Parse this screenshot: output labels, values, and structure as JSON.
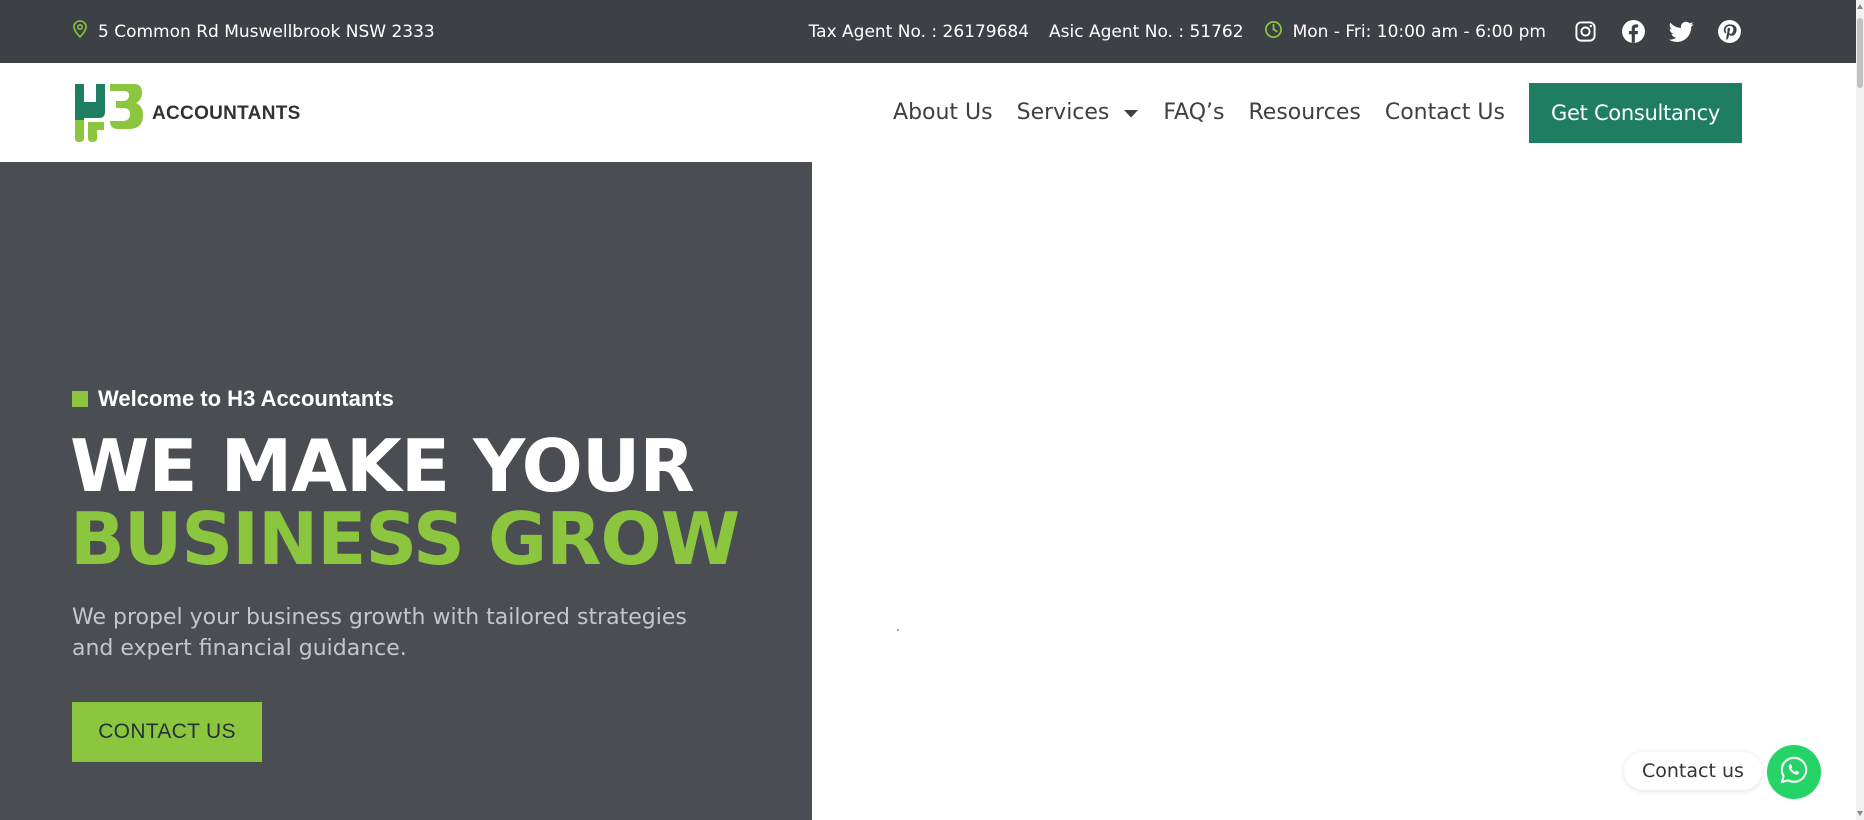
{
  "topbar": {
    "address": "5 Common Rd Muswellbrook NSW 2333",
    "tax_agent": "Tax Agent No. : 26179684",
    "asic_agent": "Asic Agent No. : 51762",
    "hours": "Mon - Fri: 10:00 am - 6:00 pm",
    "social_icons": [
      "instagram-icon",
      "facebook-icon",
      "twitter-icon",
      "pinterest-icon"
    ]
  },
  "header": {
    "logo_text": "ACCOUNTANTS",
    "nav": {
      "about": "About Us",
      "services": "Services",
      "faqs": "FAQ’s",
      "resources": "Resources",
      "contact": "Contact Us"
    },
    "cta": "Get Consultancy"
  },
  "hero": {
    "eyebrow": "Welcome to H3 Accountants",
    "headline_line1": "WE MAKE YOUR",
    "headline_line2": "BUSINESS GROW",
    "subtext": "We propel your business growth with tailored strategies and expert financial guidance.",
    "cta": "CONTACT US"
  },
  "floating_contact": {
    "label": "Contact us"
  },
  "colors": {
    "topbar_bg": "#3d4145",
    "hero_bg": "#4a4d51",
    "brand_green": "#8cc63f",
    "button_teal": "#1f7d62",
    "whatsapp_green": "#25d366"
  }
}
